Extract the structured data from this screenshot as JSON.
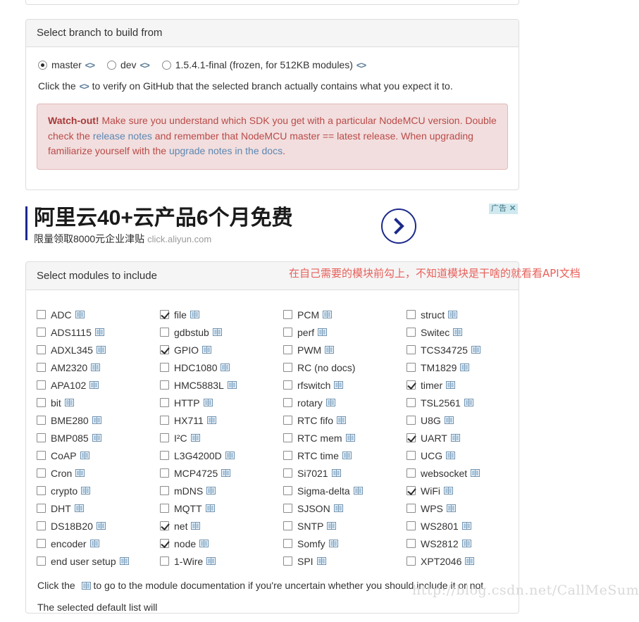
{
  "colors": {
    "panel_border": "#dddddd",
    "panel_heading_bg": "#f5f5f5",
    "alert_bg": "#f2dede",
    "alert_text": "#b94a48",
    "link_blue": "#5c87b2",
    "code_icon": "#5c7c99",
    "annotation_red": "#e8605a",
    "ad_accent": "#1b2a8a",
    "ad_badge_bg": "#cfe9ef",
    "book_icon": "#6b8fae"
  },
  "branch_panel": {
    "heading": "Select branch to build from",
    "code_icon_label": "<>",
    "options": [
      {
        "label": "master",
        "checked": true,
        "has_code_link": true
      },
      {
        "label": "dev",
        "checked": false,
        "has_code_link": true
      },
      {
        "label": "1.5.4.1-final (frozen, for 512KB modules)",
        "checked": false,
        "has_code_link": true
      }
    ],
    "help_before": "Click the",
    "help_after": "to verify on GitHub that the selected branch actually contains what you expect it to.",
    "alert": {
      "strong": "Watch-out!",
      "text_1": " Make sure you understand which SDK you get with a particular NodeMCU version. Double check the ",
      "link_1": "release notes",
      "text_2": " and remember that NodeMCU master == latest release. When upgrading familiarize yourself with the ",
      "link_2": "upgrade notes in the docs",
      "text_3": "."
    }
  },
  "ad": {
    "title": "阿里云40+云产品6个月免费",
    "subtitle": "限量领取8000元企业津贴",
    "url": "click.aliyun.com",
    "badge_label": "广告",
    "close_label": "✕",
    "arrow_icon": "chevron-right-icon"
  },
  "modules_panel": {
    "heading": "Select modules to include",
    "annotation": "在自己需要的模块前勾上，不知道模块是干啥的就看看API文档",
    "footer_before": "Click the",
    "footer_after": "to go to the module documentation if you're uncertain whether you should include it or not.",
    "footer2": "The selected default list will",
    "book_icon_name": "book-icon",
    "columns": [
      [
        {
          "label": "ADC",
          "checked": false,
          "doc": true
        },
        {
          "label": "ADS1115",
          "checked": false,
          "doc": true
        },
        {
          "label": "ADXL345",
          "checked": false,
          "doc": true
        },
        {
          "label": "AM2320",
          "checked": false,
          "doc": true
        },
        {
          "label": "APA102",
          "checked": false,
          "doc": true
        },
        {
          "label": "bit",
          "checked": false,
          "doc": true
        },
        {
          "label": "BME280",
          "checked": false,
          "doc": true
        },
        {
          "label": "BMP085",
          "checked": false,
          "doc": true
        },
        {
          "label": "CoAP",
          "checked": false,
          "doc": true
        },
        {
          "label": "Cron",
          "checked": false,
          "doc": true
        },
        {
          "label": "crypto",
          "checked": false,
          "doc": true
        },
        {
          "label": "DHT",
          "checked": false,
          "doc": true
        },
        {
          "label": "DS18B20",
          "checked": false,
          "doc": true
        },
        {
          "label": "encoder",
          "checked": false,
          "doc": true
        },
        {
          "label": "end user setup",
          "checked": false,
          "doc": true
        }
      ],
      [
        {
          "label": "file",
          "checked": true,
          "doc": true
        },
        {
          "label": "gdbstub",
          "checked": false,
          "doc": true
        },
        {
          "label": "GPIO",
          "checked": true,
          "doc": true
        },
        {
          "label": "HDC1080",
          "checked": false,
          "doc": true
        },
        {
          "label": "HMC5883L",
          "checked": false,
          "doc": true
        },
        {
          "label": "HTTP",
          "checked": false,
          "doc": true
        },
        {
          "label": "HX711",
          "checked": false,
          "doc": true
        },
        {
          "label": "I²C",
          "checked": false,
          "doc": true
        },
        {
          "label": "L3G4200D",
          "checked": false,
          "doc": true
        },
        {
          "label": "MCP4725",
          "checked": false,
          "doc": true
        },
        {
          "label": "mDNS",
          "checked": false,
          "doc": true
        },
        {
          "label": "MQTT",
          "checked": false,
          "doc": true
        },
        {
          "label": "net",
          "checked": true,
          "doc": true
        },
        {
          "label": "node",
          "checked": true,
          "doc": true
        },
        {
          "label": "1-Wire",
          "checked": false,
          "doc": true
        }
      ],
      [
        {
          "label": "PCM",
          "checked": false,
          "doc": true
        },
        {
          "label": "perf",
          "checked": false,
          "doc": true
        },
        {
          "label": "PWM",
          "checked": false,
          "doc": true
        },
        {
          "label": "RC (no docs)",
          "checked": false,
          "doc": false
        },
        {
          "label": "rfswitch",
          "checked": false,
          "doc": true
        },
        {
          "label": "rotary",
          "checked": false,
          "doc": true
        },
        {
          "label": "RTC fifo",
          "checked": false,
          "doc": true
        },
        {
          "label": "RTC mem",
          "checked": false,
          "doc": true
        },
        {
          "label": "RTC time",
          "checked": false,
          "doc": true
        },
        {
          "label": "Si7021",
          "checked": false,
          "doc": true
        },
        {
          "label": "Sigma-delta",
          "checked": false,
          "doc": true
        },
        {
          "label": "SJSON",
          "checked": false,
          "doc": true
        },
        {
          "label": "SNTP",
          "checked": false,
          "doc": true
        },
        {
          "label": "Somfy",
          "checked": false,
          "doc": true
        },
        {
          "label": "SPI",
          "checked": false,
          "doc": true
        }
      ],
      [
        {
          "label": "struct",
          "checked": false,
          "doc": true
        },
        {
          "label": "Switec",
          "checked": false,
          "doc": true
        },
        {
          "label": "TCS34725",
          "checked": false,
          "doc": true
        },
        {
          "label": "TM1829",
          "checked": false,
          "doc": true
        },
        {
          "label": "timer",
          "checked": true,
          "doc": true
        },
        {
          "label": "TSL2561",
          "checked": false,
          "doc": true
        },
        {
          "label": "U8G",
          "checked": false,
          "doc": true
        },
        {
          "label": "UART",
          "checked": true,
          "doc": true
        },
        {
          "label": "UCG",
          "checked": false,
          "doc": true
        },
        {
          "label": "websocket",
          "checked": false,
          "doc": true
        },
        {
          "label": "WiFi",
          "checked": true,
          "doc": true
        },
        {
          "label": "WPS",
          "checked": false,
          "doc": true
        },
        {
          "label": "WS2801",
          "checked": false,
          "doc": true
        },
        {
          "label": "WS2812",
          "checked": false,
          "doc": true
        },
        {
          "label": "XPT2046",
          "checked": false,
          "doc": true
        }
      ]
    ]
  },
  "watermark": "http://blog.csdn.net/CallMeSumo"
}
